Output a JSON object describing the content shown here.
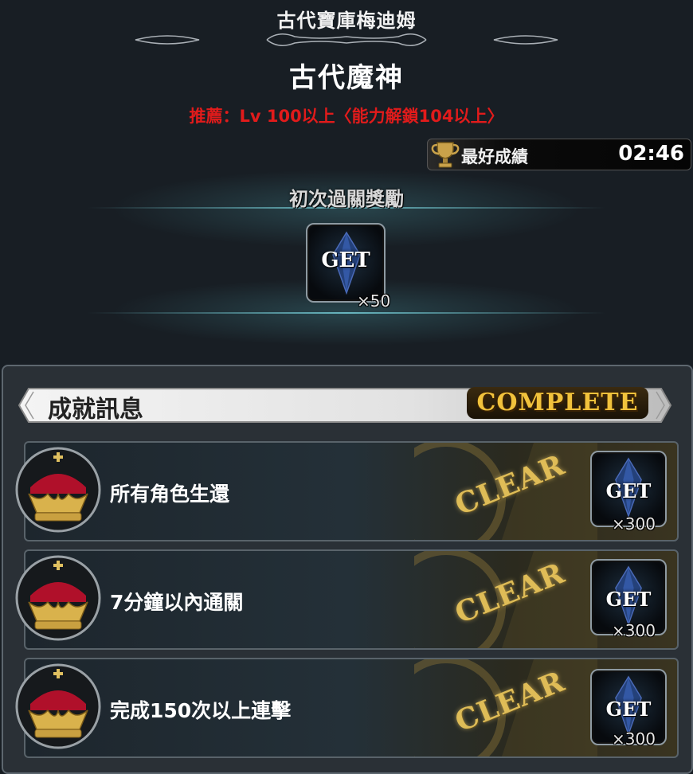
{
  "header": {
    "stage_title": "古代寶庫梅迪姆",
    "boss_name": "古代魔神",
    "recommendation": "推薦：Lv 100以上〈能力解鎖104以上〉"
  },
  "best_record": {
    "label": "最好成績",
    "time": "02:46",
    "icon": "trophy-icon"
  },
  "first_clear_reward": {
    "title": "初次過關獎勵",
    "status_label": "GET",
    "quantity": "×50",
    "icon": "blue-crystal-icon"
  },
  "achievements": {
    "title": "成就訊息",
    "status": "COMPLETE",
    "items": [
      {
        "text": "所有角色生還",
        "stamp": "CLEAR",
        "reward_label": "GET",
        "reward_qty": "×300",
        "icon": "crown-icon"
      },
      {
        "text": "7分鐘以內通關",
        "stamp": "CLEAR",
        "reward_label": "GET",
        "reward_qty": "×300",
        "icon": "crown-icon"
      },
      {
        "text": "完成150次以上連擊",
        "stamp": "CLEAR",
        "reward_label": "GET",
        "reward_qty": "×300",
        "icon": "crown-icon"
      }
    ]
  },
  "colors": {
    "recommend_red": "#e11b1b",
    "complete_gold": "#f1c23c",
    "background": "#181e24"
  }
}
